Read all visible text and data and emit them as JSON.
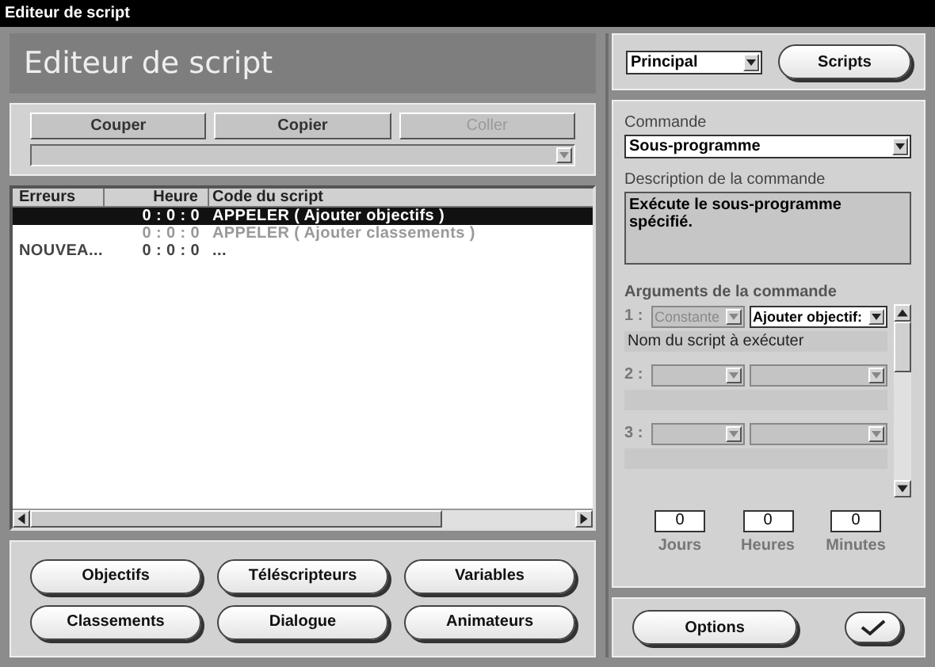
{
  "window": {
    "title": "Editeur de script"
  },
  "header": {
    "title": "Editeur de script"
  },
  "edit_buttons": [
    {
      "label": "Couper",
      "disabled": false
    },
    {
      "label": "Copier",
      "disabled": false
    },
    {
      "label": "Coller",
      "disabled": true
    }
  ],
  "script_list": {
    "columns": [
      "Erreurs",
      "Heure",
      "Code du script"
    ],
    "rows": [
      {
        "errors": "",
        "time": "0 : 0 : 0",
        "code": "APPELER ( Ajouter objectifs )",
        "selected": true,
        "disabled": false
      },
      {
        "errors": "",
        "time": "0 : 0 : 0",
        "code": "APPELER ( Ajouter classements )",
        "selected": false,
        "disabled": true
      },
      {
        "errors": "NOUVEA...",
        "time": "0 : 0 : 0",
        "code": "...",
        "selected": false,
        "disabled": false
      }
    ]
  },
  "nav_buttons": [
    "Objectifs",
    "Téléscripteurs",
    "Variables",
    "Classements",
    "Dialogue",
    "Animateurs"
  ],
  "script_select": {
    "value": "Principal"
  },
  "scripts_button": "Scripts",
  "command": {
    "label": "Commande",
    "value": "Sous-programme"
  },
  "description": {
    "label": "Description de la commande",
    "text": "Exécute le sous-programme spécifié."
  },
  "arguments": {
    "label": "Arguments de la commande",
    "items": [
      {
        "number": "1 :",
        "type": "Constante",
        "type_disabled": true,
        "value": "Ajouter objectif:",
        "value_disabled": false,
        "hint": "Nom du script à exécuter"
      },
      {
        "number": "2 :",
        "type_disabled": true,
        "value_disabled": true
      },
      {
        "number": "3 :",
        "type_disabled": true,
        "value_disabled": true
      }
    ]
  },
  "duration": [
    {
      "value": "0",
      "label": "Jours"
    },
    {
      "value": "0",
      "label": "Heures"
    },
    {
      "value": "0",
      "label": "Minutes"
    }
  ],
  "options_button": "Options"
}
